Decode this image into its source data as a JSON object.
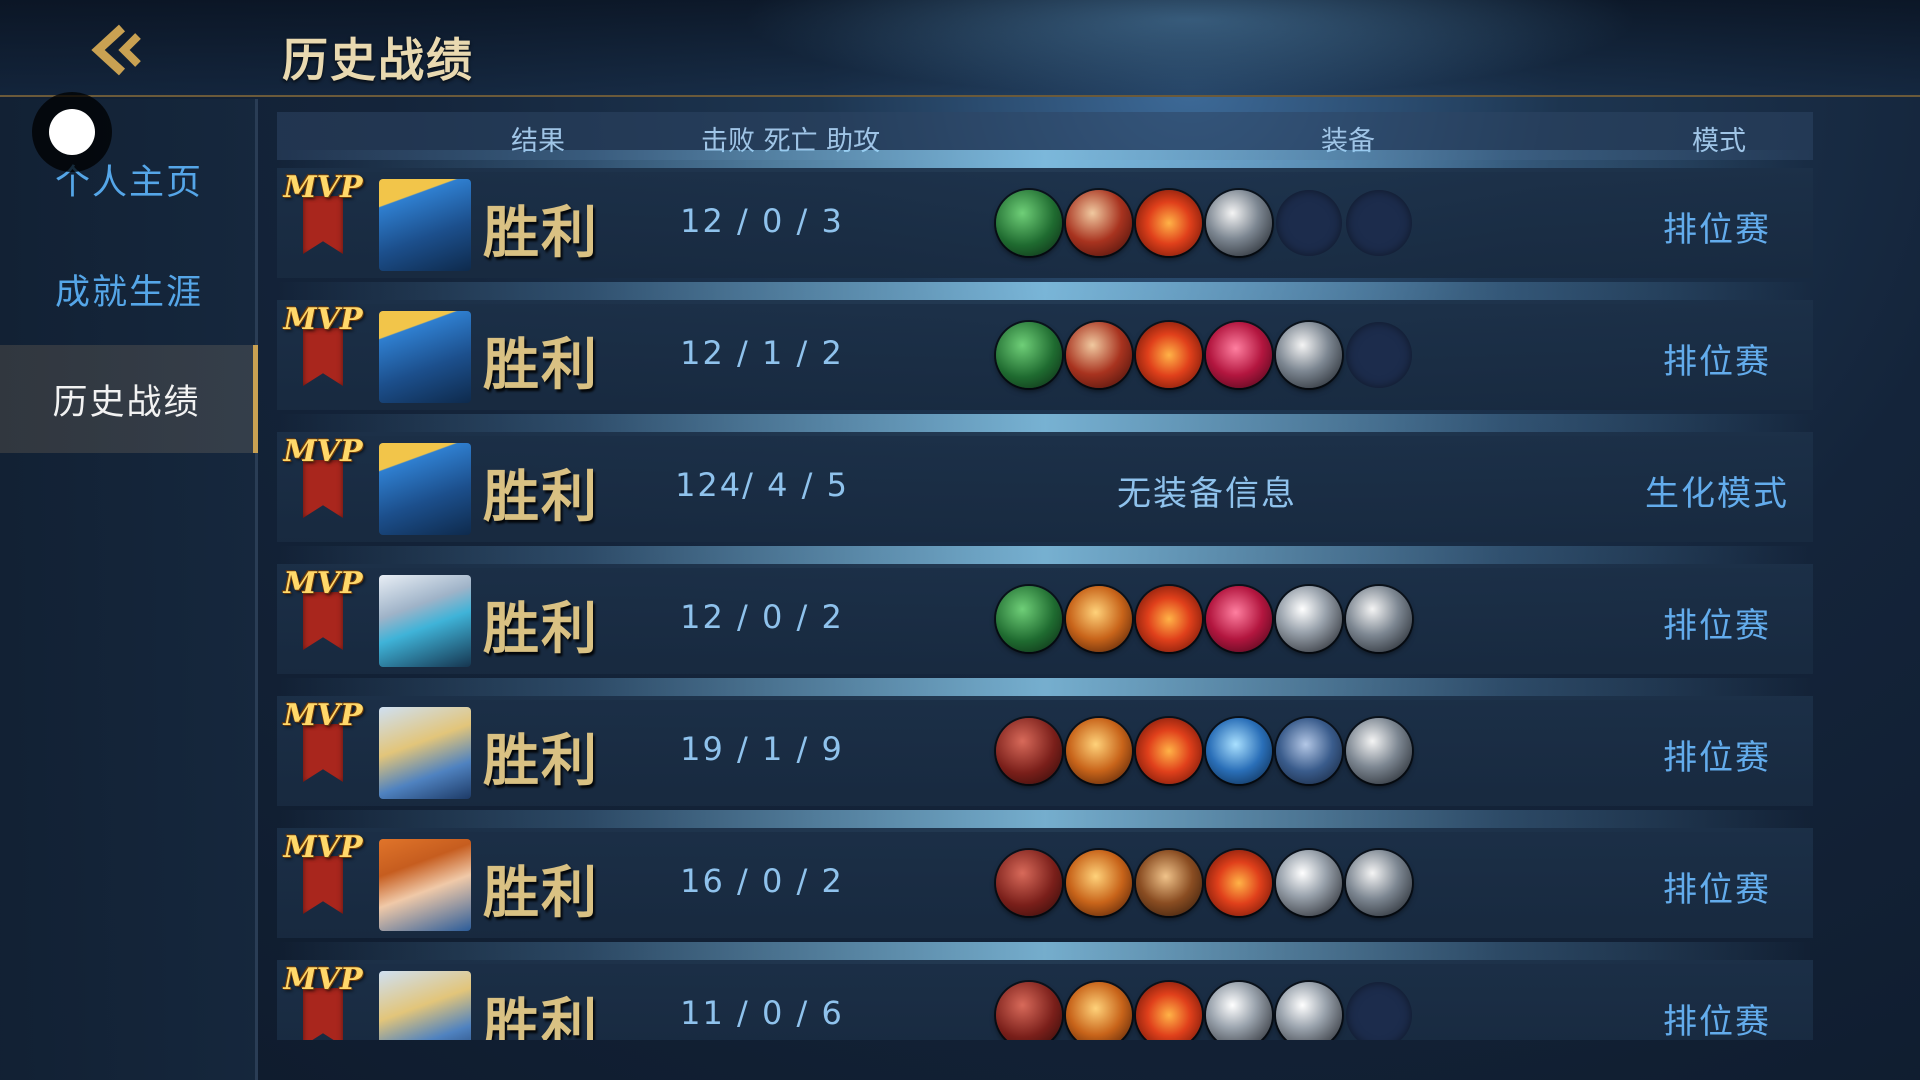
{
  "header": {
    "title": "历史战绩"
  },
  "sidebar": {
    "items": [
      {
        "label": "个人主页",
        "active": false
      },
      {
        "label": "成就生涯",
        "active": false
      },
      {
        "label": "历史战绩",
        "active": true
      }
    ]
  },
  "table": {
    "columns": {
      "result": "结果",
      "kda": "击败 死亡 助攻",
      "equipment": "装备",
      "mode": "模式"
    },
    "rows": [
      {
        "mvp": "MVP",
        "hero_icon": "hero-blue-visor-icon",
        "result": "胜利",
        "kda": "12 / 0  /  3",
        "equipment": [
          "green-boots",
          "red-blade",
          "cross-swords",
          "silver-sword",
          "empty",
          "empty"
        ],
        "no_equip": "",
        "mode": "排位赛"
      },
      {
        "mvp": "MVP",
        "hero_icon": "hero-blue-visor-icon",
        "result": "胜利",
        "kda": "12 / 1  /  2",
        "equipment": [
          "green-boots",
          "red-blade",
          "cross-swords",
          "crimson-claw",
          "silver-sword",
          "empty"
        ],
        "no_equip": "",
        "mode": "排位赛"
      },
      {
        "mvp": "MVP",
        "hero_icon": "hero-blue-visor-icon",
        "result": "胜利",
        "kda": "124/ 4  /  5",
        "equipment": [],
        "no_equip": "无装备信息",
        "mode": "生化模式"
      },
      {
        "mvp": "MVP",
        "hero_icon": "hero-masked-assassin-icon",
        "result": "胜利",
        "kda": "12 / 0  /  2",
        "equipment": [
          "green-boots",
          "orange-hammer",
          "cross-swords",
          "crimson-claw",
          "white-dagger",
          "silver-sword"
        ],
        "no_equip": "",
        "mode": "排位赛"
      },
      {
        "mvp": "MVP",
        "hero_icon": "hero-gold-mask-icon",
        "result": "胜利",
        "kda": "19 / 1  /  9",
        "equipment": [
          "red-boots",
          "orange-hammer",
          "cross-swords",
          "blue-spear",
          "blue-armor",
          "silver-sword"
        ],
        "no_equip": "",
        "mode": "排位赛"
      },
      {
        "mvp": "MVP",
        "hero_icon": "hero-orange-hair-icon",
        "result": "胜利",
        "kda": "16 / 0  /  2",
        "equipment": [
          "red-boots",
          "orange-hammer",
          "bronze-armor",
          "cross-swords",
          "white-dagger",
          "silver-sword"
        ],
        "no_equip": "",
        "mode": "排位赛"
      },
      {
        "mvp": "MVP",
        "hero_icon": "hero-gold-mask-icon",
        "result": "胜利",
        "kda": "11 / 0  /  6",
        "equipment": [
          "red-boots",
          "orange-hammer",
          "cross-swords",
          "white-dagger",
          "white-dagger",
          "empty"
        ],
        "no_equip": "",
        "mode": "排位赛"
      }
    ]
  },
  "colors": {
    "accent_gold": "#c9a152",
    "result_text": "#d9c183",
    "kda_text": "#8fc2ec",
    "mode_text": "#63acec",
    "sidebar_text": "#55a6e8"
  }
}
